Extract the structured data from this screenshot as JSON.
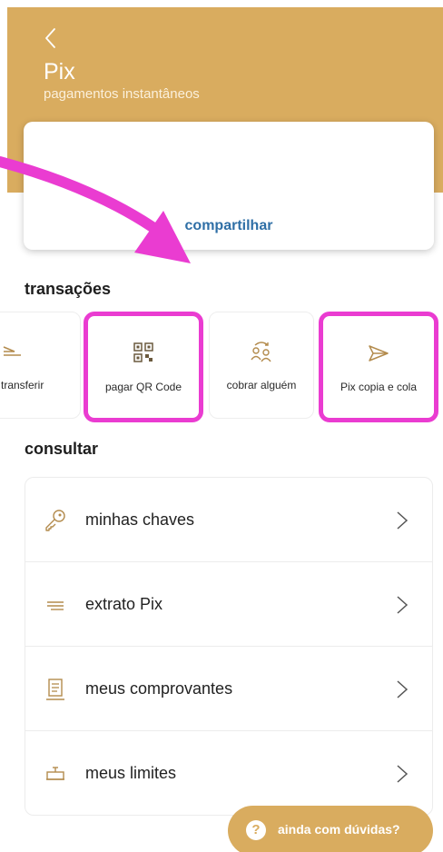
{
  "header": {
    "title": "Pix",
    "subtitle": "pagamentos instantâneos",
    "back_icon": "chevron-left-icon",
    "background_color": "#d9ac5f"
  },
  "share_card": {
    "label": "compartilhar",
    "label_color": "#2f6fa6"
  },
  "transactions": {
    "title": "transações",
    "tiles": [
      {
        "label": "transferir",
        "icon": "transfer-icon",
        "highlighted": false
      },
      {
        "label": "pagar QR Code",
        "icon": "qr-code-icon",
        "highlighted": true
      },
      {
        "label": "cobrar alguém",
        "icon": "charge-person-icon",
        "highlighted": false
      },
      {
        "label": "Pix copia e cola",
        "icon": "send-icon",
        "highlighted": true
      }
    ]
  },
  "consult": {
    "title": "consultar",
    "items": [
      {
        "label": "minhas chaves",
        "icon": "key-icon"
      },
      {
        "label": "extrato Pix",
        "icon": "statement-icon"
      },
      {
        "label": "meus comprovantes",
        "icon": "receipt-icon"
      },
      {
        "label": "meus limites",
        "icon": "limits-icon"
      }
    ]
  },
  "help_button": {
    "label": "ainda com dúvidas?",
    "icon_glyph": "?",
    "icon": "question-icon"
  },
  "annotation": {
    "highlight_color": "#ea3cd1",
    "arrow_color": "#ea3cd1"
  }
}
